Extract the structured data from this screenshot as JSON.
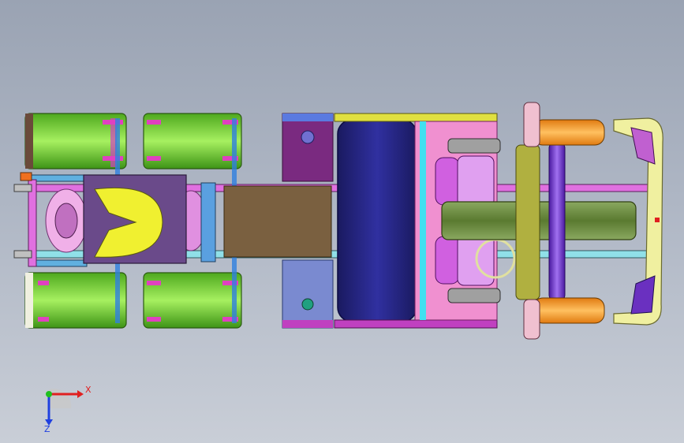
{
  "viewport": {
    "background_top": "#9aa3b3",
    "background_bottom": "#c9ced7"
  },
  "triad": {
    "x_label": "X",
    "z_label": "Z",
    "x_color": "#e02020",
    "y_color": "#20c020",
    "z_color": "#2040e0"
  },
  "part_colors": {
    "tire": "#7ee03a",
    "hub": "#e040c0",
    "fifth_wheel_plate": "#6a4a8a",
    "fifth_wheel_jaw": "#f0f030",
    "frame_rail": "#e070e0",
    "drive_shaft": "#7a6040",
    "fuel_tank": "#2a2a80",
    "cab_floor": "#f090d0",
    "seat": "#d060e0",
    "engine": "#6a8a40",
    "front_axle": "#7a3ad0",
    "front_hub": "#f0a030",
    "bumper": "#f0f0a0",
    "mirror": "#7a30c0"
  }
}
